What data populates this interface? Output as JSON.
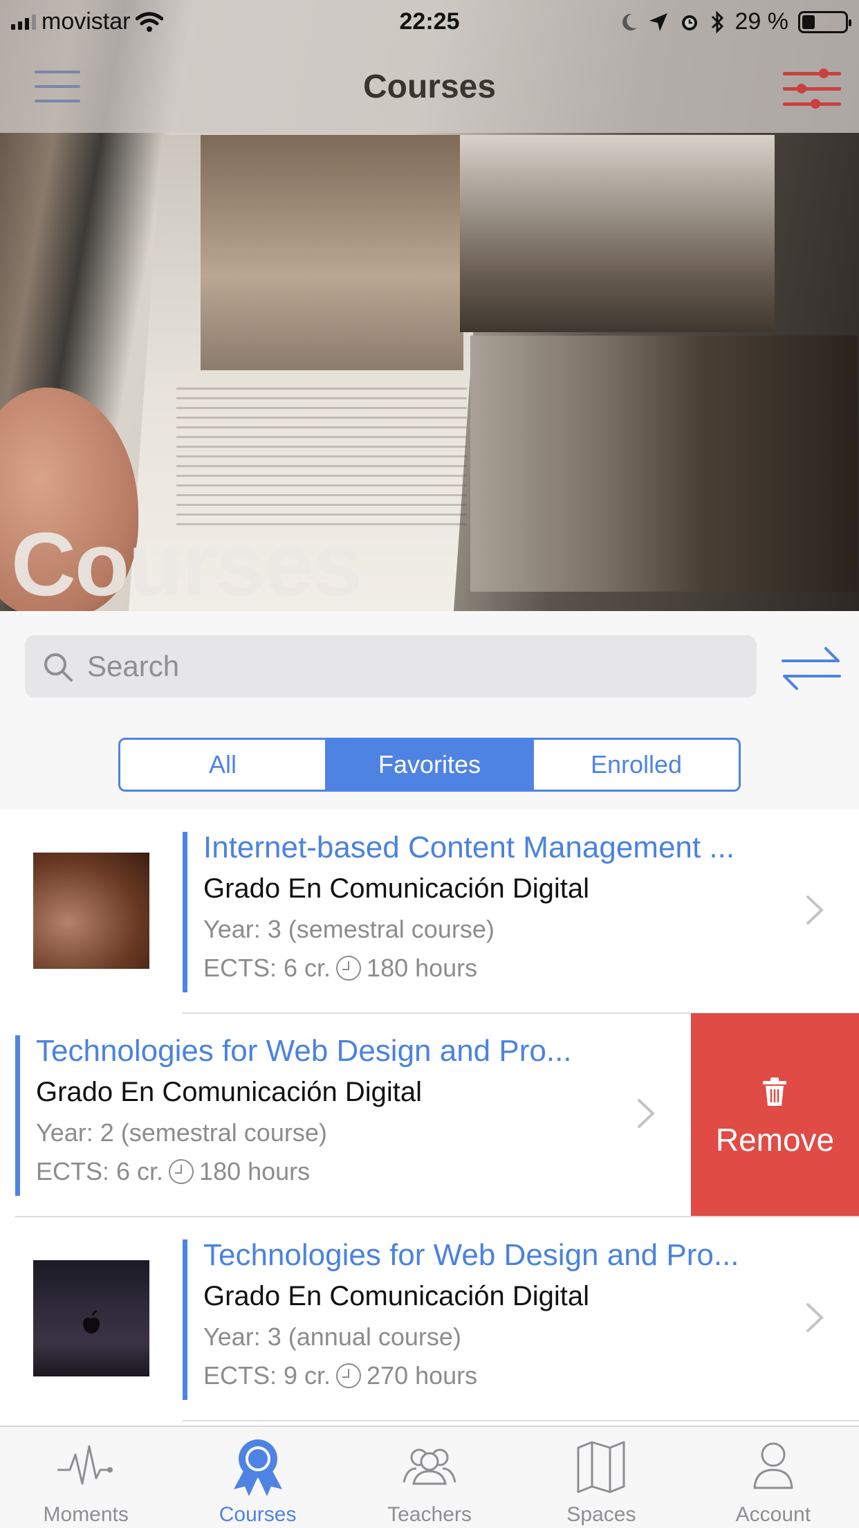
{
  "status_bar": {
    "carrier": "movistar",
    "time": "22:25",
    "battery": "29 %"
  },
  "nav": {
    "title": "Courses"
  },
  "hero": {
    "title": "Courses"
  },
  "search": {
    "placeholder": "Search"
  },
  "segments": [
    {
      "label": "All",
      "active": false
    },
    {
      "label": "Favorites",
      "active": true
    },
    {
      "label": "Enrolled",
      "active": false
    }
  ],
  "courses": [
    {
      "title": "Internet-based Content Management ...",
      "program": "Grado En Comunicación Digital",
      "year": "Year: 3 (semestral course)",
      "ects": "ECTS: 6 cr.",
      "hours": "180 hours"
    },
    {
      "title": "Technologies for Web Design and Pro...",
      "program": "Grado En Comunicación Digital",
      "year": "Year: 2 (semestral course)",
      "ects": "ECTS: 6 cr.",
      "hours": "180 hours"
    },
    {
      "title": "Technologies for Web Design and Pro...",
      "program": "Grado En Comunicación Digital",
      "year": "Year: 3 (annual course)",
      "ects": "ECTS: 9 cr.",
      "hours": "270 hours"
    }
  ],
  "swipe_action": {
    "label": "Remove",
    "color": "#e04b45"
  },
  "tabs": [
    {
      "label": "Moments",
      "icon": "pulse-icon"
    },
    {
      "label": "Courses",
      "icon": "award-ribbon-icon",
      "active": true
    },
    {
      "label": "Teachers",
      "icon": "people-group-icon"
    },
    {
      "label": "Spaces",
      "icon": "map-icon"
    },
    {
      "label": "Account",
      "icon": "person-icon"
    }
  ],
  "colors": {
    "accent": "#4f83e3",
    "destructive": "#e04b45",
    "filter_icon": "#c9413f"
  }
}
